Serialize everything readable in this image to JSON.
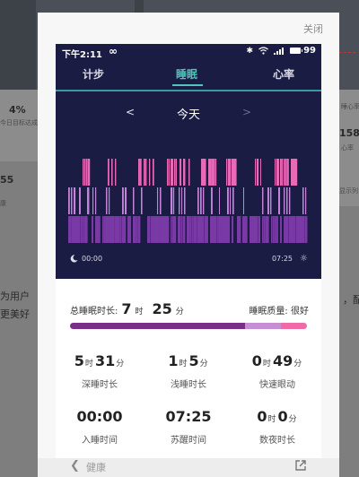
{
  "background": {
    "percent": "4%",
    "goal_text": "今日目标达成",
    "number": "158",
    "heart_text": "心率",
    "value_55": "55",
    "kang": "康",
    "left_text": "为用户",
    "left_text2": "更美好",
    "right_text": "，配",
    "right_label": "显示列",
    "right_top": "睡心率"
  },
  "modal": {
    "close_label": "关闭"
  },
  "status": {
    "time": "下午2:11",
    "infinity": "∞",
    "battery": "99"
  },
  "tabs": [
    {
      "label": "计步",
      "active": false
    },
    {
      "label": "睡眠",
      "active": true
    },
    {
      "label": "心率",
      "active": false
    }
  ],
  "date_nav": {
    "prev": "<",
    "label": "今天",
    "next": ">"
  },
  "chart_data": {
    "type": "heatmap",
    "start": "00:00",
    "end": "07:25",
    "rows": [
      "awake",
      "light",
      "deep"
    ],
    "colors": {
      "awake": "#e86ab6",
      "light": "#c482d8",
      "deep": "#7a3aa6"
    }
  },
  "summary": {
    "total_label": "总睡眠时长:",
    "total_hours": "7",
    "hour_unit": "时",
    "total_minutes": "25",
    "minute_unit": "分",
    "quality_label": "睡眠质量:",
    "quality_value": "很好",
    "quality_segments": [
      {
        "name": "deep",
        "fraction": 0.74,
        "color": "#7a2f86"
      },
      {
        "name": "light",
        "fraction": 0.15,
        "color": "#c58fd3"
      },
      {
        "name": "rem",
        "fraction": 0.11,
        "color": "#ef6aa7"
      }
    ],
    "stats": [
      {
        "h": "5",
        "hu": "时",
        "m": "31",
        "mu": "分",
        "label": "深睡时长"
      },
      {
        "h": "1",
        "hu": "时",
        "m": "5",
        "mu": "分",
        "label": "浅睡时长"
      },
      {
        "h": "0",
        "hu": "时",
        "m": "49",
        "mu": "分",
        "label": "快速眼动"
      },
      {
        "time": "00:00",
        "label": "入睡时间"
      },
      {
        "time": "07:25",
        "label": "苏醒时间"
      },
      {
        "h": "0",
        "hu": "时",
        "m": "0",
        "mu": "分",
        "label": "数夜时长"
      }
    ]
  },
  "footer": {
    "back_label": "健康"
  },
  "colors": {
    "accent": "#4fc6b9",
    "dark_bg": "#1b1c44"
  }
}
